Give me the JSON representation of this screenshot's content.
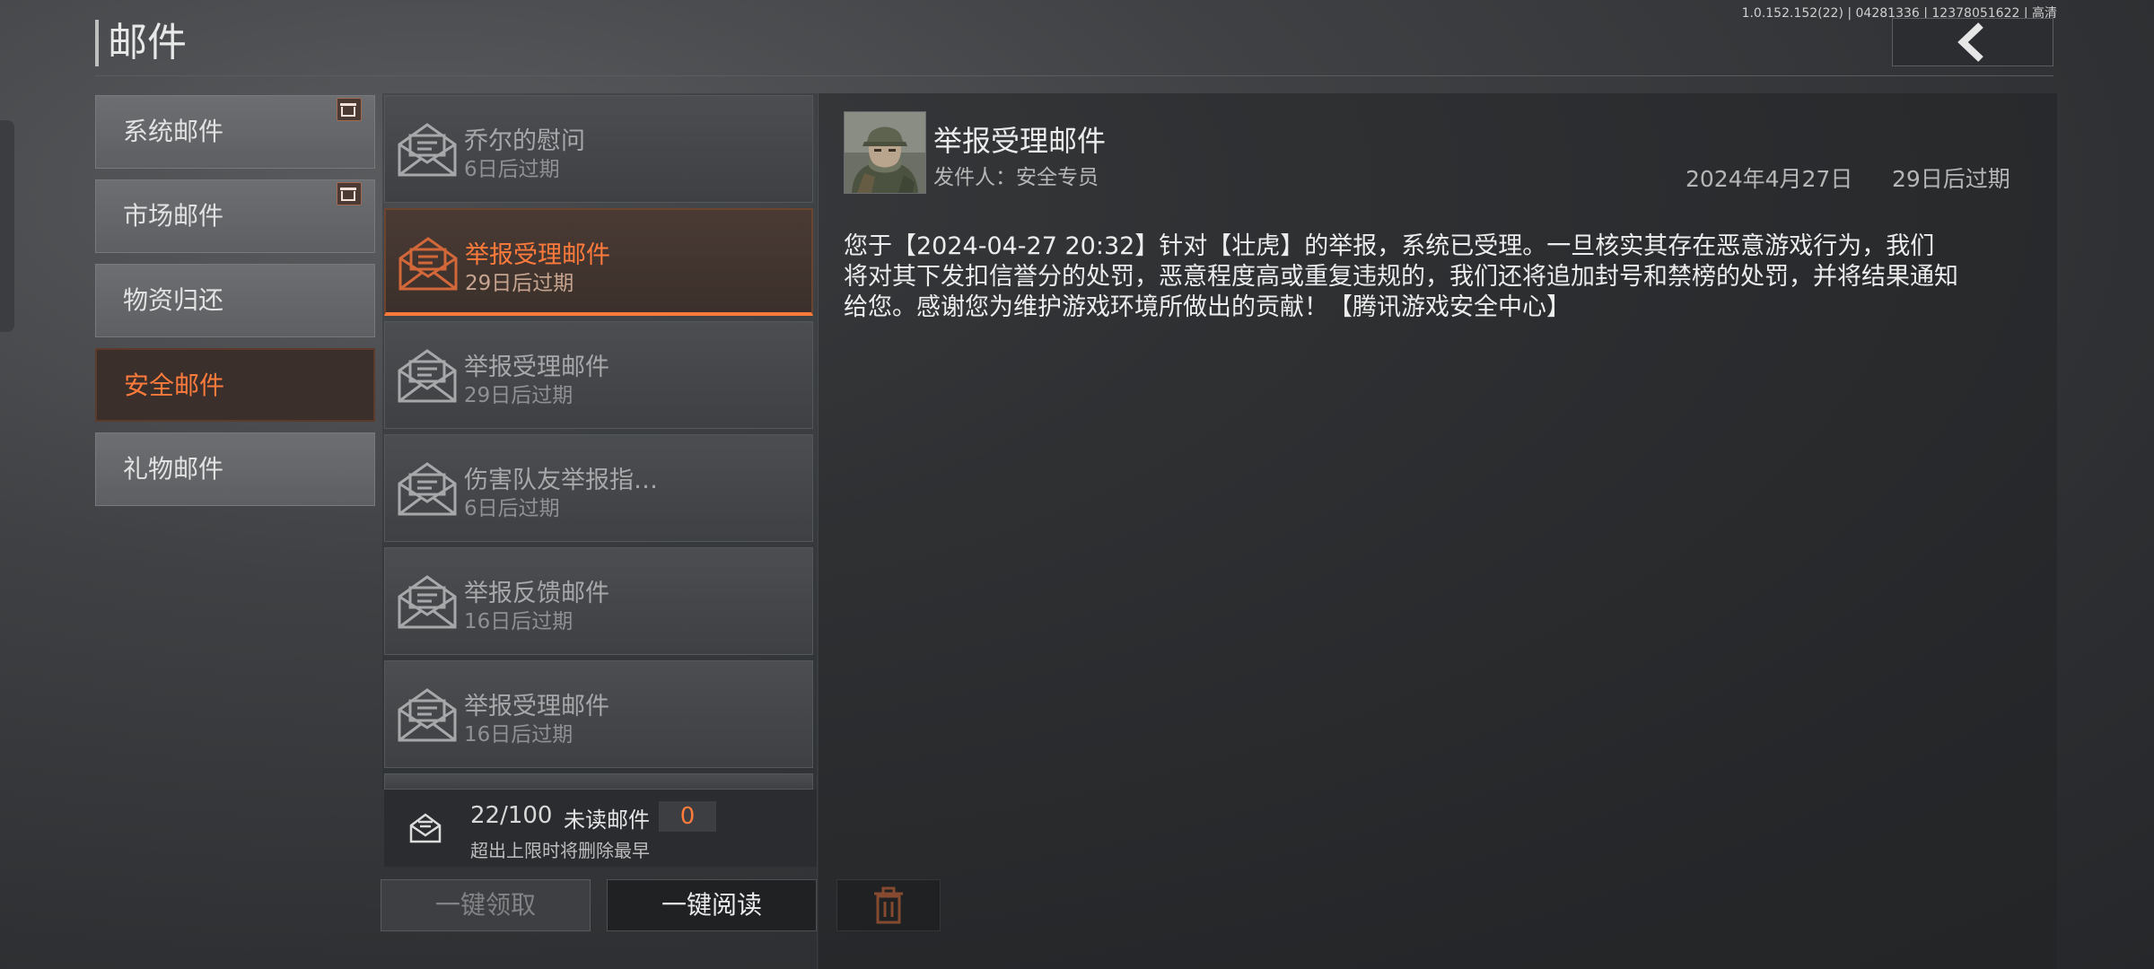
{
  "header": {
    "title": "邮件",
    "version": "1.0.152.152(22) | 04281336 | 12378051622 | 高清"
  },
  "categories": [
    {
      "label": "系统邮件",
      "gift": true
    },
    {
      "label": "市场邮件",
      "gift": true
    },
    {
      "label": "物资归还",
      "gift": false
    },
    {
      "label": "安全邮件",
      "gift": false,
      "active": true
    },
    {
      "label": "礼物邮件",
      "gift": false
    }
  ],
  "mails": [
    {
      "title": "乔尔的慰问",
      "expiry": "6日后过期"
    },
    {
      "title": "举报受理邮件",
      "expiry": "29日后过期",
      "active": true
    },
    {
      "title": "举报受理邮件",
      "expiry": "29日后过期"
    },
    {
      "title": "伤害队友举报指…",
      "expiry": "6日后过期"
    },
    {
      "title": "举报反馈邮件",
      "expiry": "16日后过期"
    },
    {
      "title": "举报受理邮件",
      "expiry": "16日后过期"
    }
  ],
  "counter": {
    "count": "22/100",
    "unread_label": "未读邮件",
    "unread_value": "0",
    "note": "超出上限时将删除最早"
  },
  "buttons": {
    "claim_all": "一键领取",
    "read_all": "一键阅读"
  },
  "detail": {
    "title": "举报受理邮件",
    "sender": "发件人：安全专员",
    "date": "2024年4月27日",
    "expiry": "29日后过期",
    "body": "您于【2024-04-27 20:32】针对【壮虎】的举报，系统已受理。一旦核实其存在恶意游戏行为，我们\n将对其下发扣信誉分的处罚，恶意程度高或重复违规的，我们还将追加封号和禁榜的处罚，并将结果通知\n给您。感谢您为维护游戏环境所做出的贡献！【腾讯游戏安全中心】"
  },
  "colors": {
    "accent": "#ff7b3c",
    "background": "#2c2e31"
  },
  "icons": {
    "back": "chevron-left-icon",
    "envelope": "envelope-open-icon",
    "trash": "trash-icon",
    "gift": "gift-icon"
  }
}
